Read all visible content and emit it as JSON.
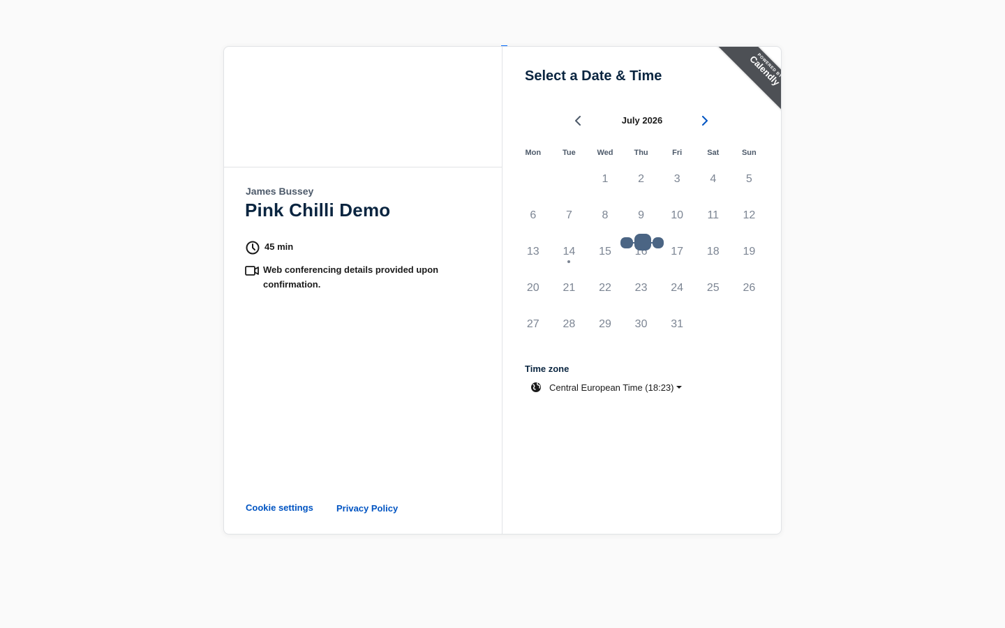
{
  "event": {
    "organizer": "James Bussey",
    "title": "Pink Chilli Demo",
    "duration": "45 min",
    "location_note": "Web conferencing details provided upon confirmation."
  },
  "footer": {
    "cookie_settings": "Cookie settings",
    "privacy_policy": "Privacy Policy"
  },
  "calendar": {
    "heading": "Select a Date & Time",
    "ribbon": {
      "small": "POWERED BY",
      "brand": "Calendly"
    },
    "month_label": "July 2026",
    "weekdays": [
      "Mon",
      "Tue",
      "Wed",
      "Thu",
      "Fri",
      "Sat",
      "Sun"
    ],
    "weeks": [
      [
        "",
        "",
        "1",
        "2",
        "3",
        "4",
        "5"
      ],
      [
        "6",
        "7",
        "8",
        "9",
        "10",
        "11",
        "12"
      ],
      [
        "13",
        "14",
        "15",
        "16",
        "17",
        "18",
        "19"
      ],
      [
        "20",
        "21",
        "22",
        "23",
        "24",
        "25",
        "26"
      ],
      [
        "27",
        "28",
        "29",
        "30",
        "31",
        "",
        ""
      ]
    ],
    "today": "14"
  },
  "timezone": {
    "label": "Time zone",
    "value": "Central European Time (18:23)"
  },
  "colors": {
    "accent": "#0069ff",
    "link": "#0054c2",
    "text": "#0a2540",
    "loader": "#4b6584"
  }
}
